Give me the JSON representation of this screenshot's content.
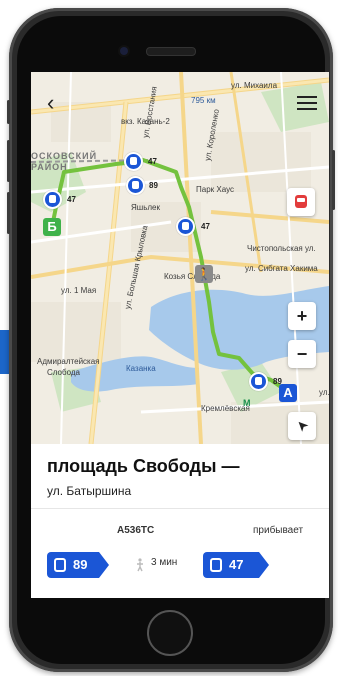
{
  "map": {
    "labels": {
      "street_mikhaila": "ул. Михаила",
      "distance": "795 км",
      "station_kazan2": "вкз. Казань-2",
      "district_moskovsky": "ОСКОВСКИЙ",
      "district_rayon": "РАЙОН",
      "street_vosstaniya": "ул. Восстания",
      "street_korolenko": "ул. Короленко",
      "street_vakhitova": "ул. Вахитова",
      "park_house": "Парк Хаус",
      "yashlek": "Яшьлек",
      "street_bolshaya_krylovka": "ул. Большая Крыловка",
      "street_chistopolskaya": "Чистопольская ул.",
      "street_sibgata": "ул. Сибгата Хакима",
      "street_1may": "ул. 1 Мая",
      "kozya_sloboda": "Козья Слобода",
      "admiralteyskaya": "Адмиралтейская",
      "sloboda": "Слобода",
      "kazanka": "Казанка",
      "kremlevskaya": "Кремлёвская",
      "street_lavr": "ул."
    },
    "stops": [
      "47",
      "89",
      "47",
      "47",
      "89"
    ],
    "marker_a": "А",
    "marker_b": "Б",
    "metro": "М",
    "zoom_in": "+",
    "zoom_out": "−",
    "locate": "➤",
    "back": "‹"
  },
  "route": {
    "title": "площадь Свободы —",
    "subtitle": "ул. Батыршина",
    "plate": "А536ТС",
    "status": "прибывает",
    "first_bus": "89",
    "walk_time": "3 мин",
    "second_bus": "47"
  },
  "colors": {
    "accent": "#1b56d6",
    "route_green": "#74c23e",
    "water": "#a7c9eb",
    "alert_red": "#e23c3c"
  }
}
